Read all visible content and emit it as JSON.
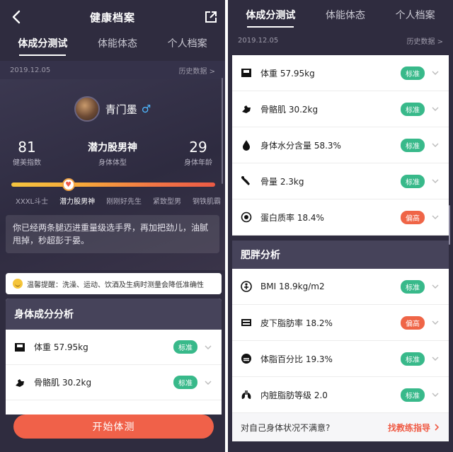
{
  "left": {
    "header": {
      "title": "健康档案"
    },
    "tabs": [
      {
        "label": "体成分测试"
      },
      {
        "label": "体能体态"
      },
      {
        "label": "个人档案"
      }
    ],
    "date": "2019.12.05",
    "history": "历史数据 >",
    "user": {
      "name": "青门墨",
      "gender_symbol": "♂"
    },
    "stats": {
      "fitness_index": {
        "value": "81",
        "label": "健美指数"
      },
      "body_type": {
        "value": "潜力股男神",
        "label": "身体体型"
      },
      "body_age": {
        "value": "29",
        "label": "身体年龄"
      }
    },
    "levels": [
      "XXXL斗士",
      "潜力股男神",
      "刚刚好先生",
      "紧致型男",
      "钢铁肌霸"
    ],
    "level_position": 0.28,
    "description": "你已经两条腿迈进重量级选手界，再加把劲儿，油腻甩掉，秒超彭于晏。",
    "tip": "温馨提醒：洗澡、运动、饮酒及生病时测量会降低准确性",
    "analysis_title": "身体成分分析",
    "rows": [
      {
        "label": "体重 57.95kg",
        "badge": "标准",
        "icon": "scale-icon"
      },
      {
        "label": "骨骼肌 30.2kg",
        "badge": "标准",
        "icon": "muscle-icon"
      }
    ],
    "start_button": "开始体测"
  },
  "right": {
    "tabs": [
      {
        "label": "体成分测试"
      },
      {
        "label": "体能体态"
      },
      {
        "label": "个人档案"
      }
    ],
    "date": "2019.12.05",
    "history": "历史数据 >",
    "composition_rows": [
      {
        "label": "体重 57.95kg",
        "badge": "标准",
        "status": "normal",
        "icon": "scale-icon"
      },
      {
        "label": "骨骼肌 30.2kg",
        "badge": "标准",
        "status": "normal",
        "icon": "muscle-icon"
      },
      {
        "label": "身体水分含量 58.3%",
        "badge": "标准",
        "status": "normal",
        "icon": "water-drop-icon"
      },
      {
        "label": "骨量 2.3kg",
        "badge": "标准",
        "status": "normal",
        "icon": "bone-icon"
      },
      {
        "label": "蛋白质率 18.4%",
        "badge": "偏高",
        "status": "high",
        "icon": "protein-icon"
      }
    ],
    "obesity_title": "肥胖分析",
    "obesity_rows": [
      {
        "label": "BMI 18.9kg/m2",
        "badge": "标准",
        "status": "normal",
        "icon": "bmi-icon"
      },
      {
        "label": "皮下脂肪率 18.2%",
        "badge": "偏高",
        "status": "high",
        "icon": "subcutaneous-fat-icon"
      },
      {
        "label": "体脂百分比 19.3%",
        "badge": "标准",
        "status": "normal",
        "icon": "body-fat-icon"
      },
      {
        "label": "内脏脂肪等级 2.0",
        "badge": "标准",
        "status": "normal",
        "icon": "lungs-icon"
      }
    ],
    "footer": {
      "question": "对自己身体状况不满意?",
      "link": "找教练指导"
    }
  },
  "colors": {
    "accent": "#f06149",
    "normal": "#38b98a",
    "high": "#ef6547",
    "background": "#2f2c3f"
  }
}
